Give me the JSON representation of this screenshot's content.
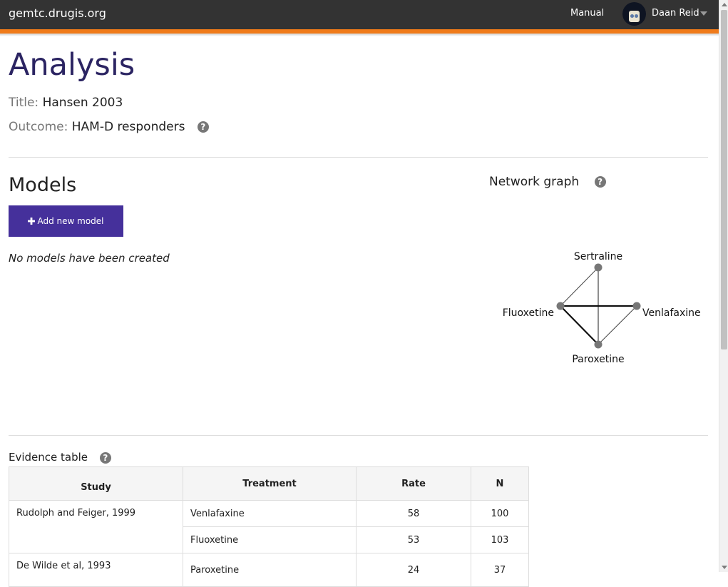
{
  "navbar": {
    "brand": "gemtc.drugis.org",
    "manual_link": "Manual",
    "username": "Daan Reid",
    "accent_color": "#f07b1a",
    "background_color": "#333333"
  },
  "page": {
    "title": "Analysis",
    "analysis_title_label": "Title:",
    "analysis_title_value": "Hansen 2003",
    "outcome_label": "Outcome:",
    "outcome_value": "HAM-D responders",
    "help_icon_glyph": "?"
  },
  "models": {
    "heading": "Models",
    "add_button_label": "Add new model",
    "add_button_icon": "plus-icon",
    "add_button_color": "#45309b",
    "empty_text": "No models have been created"
  },
  "network": {
    "heading": "Network graph",
    "nodes": [
      "Sertraline",
      "Fluoxetine",
      "Venlafaxine",
      "Paroxetine"
    ]
  },
  "evidence": {
    "heading": "Evidence table",
    "headers": [
      "Study",
      "Treatment",
      "Rate",
      "N"
    ],
    "rows": [
      {
        "study": "Rudolph and Feiger, 1999",
        "treatment": "Venlafaxine",
        "rate": "58",
        "n": "100"
      },
      {
        "study": "",
        "treatment": "Fluoxetine",
        "rate": "53",
        "n": "103"
      },
      {
        "study": "De Wilde et al, 1993",
        "treatment": "Paroxetine",
        "rate": "24",
        "n": "37"
      }
    ]
  }
}
